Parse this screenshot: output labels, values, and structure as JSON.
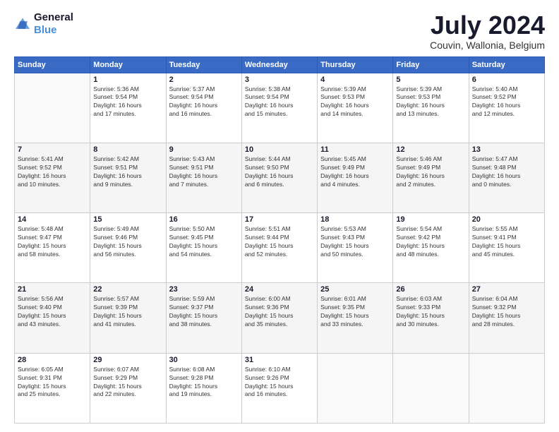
{
  "logo": {
    "line1": "General",
    "line2": "Blue"
  },
  "title": "July 2024",
  "subtitle": "Couvin, Wallonia, Belgium",
  "weekdays": [
    "Sunday",
    "Monday",
    "Tuesday",
    "Wednesday",
    "Thursday",
    "Friday",
    "Saturday"
  ],
  "weeks": [
    [
      {
        "day": "",
        "info": ""
      },
      {
        "day": "1",
        "info": "Sunrise: 5:36 AM\nSunset: 9:54 PM\nDaylight: 16 hours\nand 17 minutes."
      },
      {
        "day": "2",
        "info": "Sunrise: 5:37 AM\nSunset: 9:54 PM\nDaylight: 16 hours\nand 16 minutes."
      },
      {
        "day": "3",
        "info": "Sunrise: 5:38 AM\nSunset: 9:54 PM\nDaylight: 16 hours\nand 15 minutes."
      },
      {
        "day": "4",
        "info": "Sunrise: 5:39 AM\nSunset: 9:53 PM\nDaylight: 16 hours\nand 14 minutes."
      },
      {
        "day": "5",
        "info": "Sunrise: 5:39 AM\nSunset: 9:53 PM\nDaylight: 16 hours\nand 13 minutes."
      },
      {
        "day": "6",
        "info": "Sunrise: 5:40 AM\nSunset: 9:52 PM\nDaylight: 16 hours\nand 12 minutes."
      }
    ],
    [
      {
        "day": "7",
        "info": "Sunrise: 5:41 AM\nSunset: 9:52 PM\nDaylight: 16 hours\nand 10 minutes."
      },
      {
        "day": "8",
        "info": "Sunrise: 5:42 AM\nSunset: 9:51 PM\nDaylight: 16 hours\nand 9 minutes."
      },
      {
        "day": "9",
        "info": "Sunrise: 5:43 AM\nSunset: 9:51 PM\nDaylight: 16 hours\nand 7 minutes."
      },
      {
        "day": "10",
        "info": "Sunrise: 5:44 AM\nSunset: 9:50 PM\nDaylight: 16 hours\nand 6 minutes."
      },
      {
        "day": "11",
        "info": "Sunrise: 5:45 AM\nSunset: 9:49 PM\nDaylight: 16 hours\nand 4 minutes."
      },
      {
        "day": "12",
        "info": "Sunrise: 5:46 AM\nSunset: 9:49 PM\nDaylight: 16 hours\nand 2 minutes."
      },
      {
        "day": "13",
        "info": "Sunrise: 5:47 AM\nSunset: 9:48 PM\nDaylight: 16 hours\nand 0 minutes."
      }
    ],
    [
      {
        "day": "14",
        "info": "Sunrise: 5:48 AM\nSunset: 9:47 PM\nDaylight: 15 hours\nand 58 minutes."
      },
      {
        "day": "15",
        "info": "Sunrise: 5:49 AM\nSunset: 9:46 PM\nDaylight: 15 hours\nand 56 minutes."
      },
      {
        "day": "16",
        "info": "Sunrise: 5:50 AM\nSunset: 9:45 PM\nDaylight: 15 hours\nand 54 minutes."
      },
      {
        "day": "17",
        "info": "Sunrise: 5:51 AM\nSunset: 9:44 PM\nDaylight: 15 hours\nand 52 minutes."
      },
      {
        "day": "18",
        "info": "Sunrise: 5:53 AM\nSunset: 9:43 PM\nDaylight: 15 hours\nand 50 minutes."
      },
      {
        "day": "19",
        "info": "Sunrise: 5:54 AM\nSunset: 9:42 PM\nDaylight: 15 hours\nand 48 minutes."
      },
      {
        "day": "20",
        "info": "Sunrise: 5:55 AM\nSunset: 9:41 PM\nDaylight: 15 hours\nand 45 minutes."
      }
    ],
    [
      {
        "day": "21",
        "info": "Sunrise: 5:56 AM\nSunset: 9:40 PM\nDaylight: 15 hours\nand 43 minutes."
      },
      {
        "day": "22",
        "info": "Sunrise: 5:57 AM\nSunset: 9:39 PM\nDaylight: 15 hours\nand 41 minutes."
      },
      {
        "day": "23",
        "info": "Sunrise: 5:59 AM\nSunset: 9:37 PM\nDaylight: 15 hours\nand 38 minutes."
      },
      {
        "day": "24",
        "info": "Sunrise: 6:00 AM\nSunset: 9:36 PM\nDaylight: 15 hours\nand 35 minutes."
      },
      {
        "day": "25",
        "info": "Sunrise: 6:01 AM\nSunset: 9:35 PM\nDaylight: 15 hours\nand 33 minutes."
      },
      {
        "day": "26",
        "info": "Sunrise: 6:03 AM\nSunset: 9:33 PM\nDaylight: 15 hours\nand 30 minutes."
      },
      {
        "day": "27",
        "info": "Sunrise: 6:04 AM\nSunset: 9:32 PM\nDaylight: 15 hours\nand 28 minutes."
      }
    ],
    [
      {
        "day": "28",
        "info": "Sunrise: 6:05 AM\nSunset: 9:31 PM\nDaylight: 15 hours\nand 25 minutes."
      },
      {
        "day": "29",
        "info": "Sunrise: 6:07 AM\nSunset: 9:29 PM\nDaylight: 15 hours\nand 22 minutes."
      },
      {
        "day": "30",
        "info": "Sunrise: 6:08 AM\nSunset: 9:28 PM\nDaylight: 15 hours\nand 19 minutes."
      },
      {
        "day": "31",
        "info": "Sunrise: 6:10 AM\nSunset: 9:26 PM\nDaylight: 15 hours\nand 16 minutes."
      },
      {
        "day": "",
        "info": ""
      },
      {
        "day": "",
        "info": ""
      },
      {
        "day": "",
        "info": ""
      }
    ]
  ]
}
